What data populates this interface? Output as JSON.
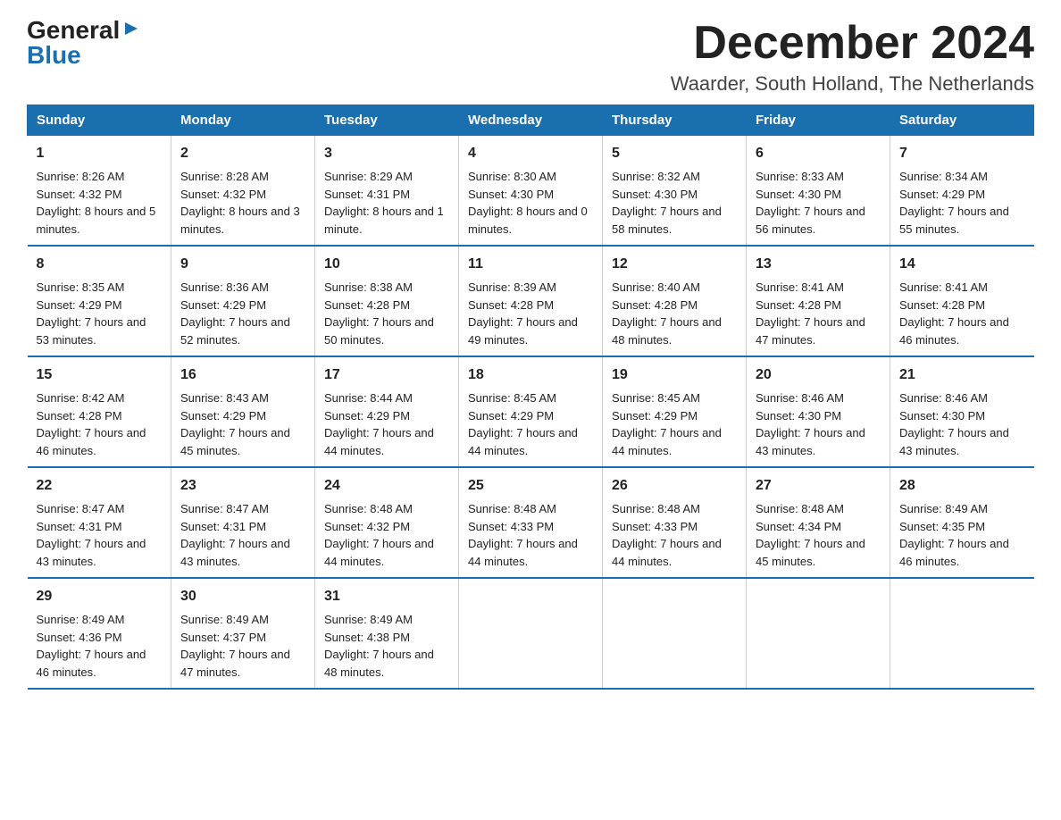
{
  "logo": {
    "general": "General",
    "triangle": "▶",
    "blue": "Blue"
  },
  "header": {
    "month": "December 2024",
    "location": "Waarder, South Holland, The Netherlands"
  },
  "days": [
    "Sunday",
    "Monday",
    "Tuesday",
    "Wednesday",
    "Thursday",
    "Friday",
    "Saturday"
  ],
  "weeks": [
    [
      {
        "date": "1",
        "sunrise": "Sunrise: 8:26 AM",
        "sunset": "Sunset: 4:32 PM",
        "daylight": "Daylight: 8 hours and 5 minutes."
      },
      {
        "date": "2",
        "sunrise": "Sunrise: 8:28 AM",
        "sunset": "Sunset: 4:32 PM",
        "daylight": "Daylight: 8 hours and 3 minutes."
      },
      {
        "date": "3",
        "sunrise": "Sunrise: 8:29 AM",
        "sunset": "Sunset: 4:31 PM",
        "daylight": "Daylight: 8 hours and 1 minute."
      },
      {
        "date": "4",
        "sunrise": "Sunrise: 8:30 AM",
        "sunset": "Sunset: 4:30 PM",
        "daylight": "Daylight: 8 hours and 0 minutes."
      },
      {
        "date": "5",
        "sunrise": "Sunrise: 8:32 AM",
        "sunset": "Sunset: 4:30 PM",
        "daylight": "Daylight: 7 hours and 58 minutes."
      },
      {
        "date": "6",
        "sunrise": "Sunrise: 8:33 AM",
        "sunset": "Sunset: 4:30 PM",
        "daylight": "Daylight: 7 hours and 56 minutes."
      },
      {
        "date": "7",
        "sunrise": "Sunrise: 8:34 AM",
        "sunset": "Sunset: 4:29 PM",
        "daylight": "Daylight: 7 hours and 55 minutes."
      }
    ],
    [
      {
        "date": "8",
        "sunrise": "Sunrise: 8:35 AM",
        "sunset": "Sunset: 4:29 PM",
        "daylight": "Daylight: 7 hours and 53 minutes."
      },
      {
        "date": "9",
        "sunrise": "Sunrise: 8:36 AM",
        "sunset": "Sunset: 4:29 PM",
        "daylight": "Daylight: 7 hours and 52 minutes."
      },
      {
        "date": "10",
        "sunrise": "Sunrise: 8:38 AM",
        "sunset": "Sunset: 4:28 PM",
        "daylight": "Daylight: 7 hours and 50 minutes."
      },
      {
        "date": "11",
        "sunrise": "Sunrise: 8:39 AM",
        "sunset": "Sunset: 4:28 PM",
        "daylight": "Daylight: 7 hours and 49 minutes."
      },
      {
        "date": "12",
        "sunrise": "Sunrise: 8:40 AM",
        "sunset": "Sunset: 4:28 PM",
        "daylight": "Daylight: 7 hours and 48 minutes."
      },
      {
        "date": "13",
        "sunrise": "Sunrise: 8:41 AM",
        "sunset": "Sunset: 4:28 PM",
        "daylight": "Daylight: 7 hours and 47 minutes."
      },
      {
        "date": "14",
        "sunrise": "Sunrise: 8:41 AM",
        "sunset": "Sunset: 4:28 PM",
        "daylight": "Daylight: 7 hours and 46 minutes."
      }
    ],
    [
      {
        "date": "15",
        "sunrise": "Sunrise: 8:42 AM",
        "sunset": "Sunset: 4:28 PM",
        "daylight": "Daylight: 7 hours and 46 minutes."
      },
      {
        "date": "16",
        "sunrise": "Sunrise: 8:43 AM",
        "sunset": "Sunset: 4:29 PM",
        "daylight": "Daylight: 7 hours and 45 minutes."
      },
      {
        "date": "17",
        "sunrise": "Sunrise: 8:44 AM",
        "sunset": "Sunset: 4:29 PM",
        "daylight": "Daylight: 7 hours and 44 minutes."
      },
      {
        "date": "18",
        "sunrise": "Sunrise: 8:45 AM",
        "sunset": "Sunset: 4:29 PM",
        "daylight": "Daylight: 7 hours and 44 minutes."
      },
      {
        "date": "19",
        "sunrise": "Sunrise: 8:45 AM",
        "sunset": "Sunset: 4:29 PM",
        "daylight": "Daylight: 7 hours and 44 minutes."
      },
      {
        "date": "20",
        "sunrise": "Sunrise: 8:46 AM",
        "sunset": "Sunset: 4:30 PM",
        "daylight": "Daylight: 7 hours and 43 minutes."
      },
      {
        "date": "21",
        "sunrise": "Sunrise: 8:46 AM",
        "sunset": "Sunset: 4:30 PM",
        "daylight": "Daylight: 7 hours and 43 minutes."
      }
    ],
    [
      {
        "date": "22",
        "sunrise": "Sunrise: 8:47 AM",
        "sunset": "Sunset: 4:31 PM",
        "daylight": "Daylight: 7 hours and 43 minutes."
      },
      {
        "date": "23",
        "sunrise": "Sunrise: 8:47 AM",
        "sunset": "Sunset: 4:31 PM",
        "daylight": "Daylight: 7 hours and 43 minutes."
      },
      {
        "date": "24",
        "sunrise": "Sunrise: 8:48 AM",
        "sunset": "Sunset: 4:32 PM",
        "daylight": "Daylight: 7 hours and 44 minutes."
      },
      {
        "date": "25",
        "sunrise": "Sunrise: 8:48 AM",
        "sunset": "Sunset: 4:33 PM",
        "daylight": "Daylight: 7 hours and 44 minutes."
      },
      {
        "date": "26",
        "sunrise": "Sunrise: 8:48 AM",
        "sunset": "Sunset: 4:33 PM",
        "daylight": "Daylight: 7 hours and 44 minutes."
      },
      {
        "date": "27",
        "sunrise": "Sunrise: 8:48 AM",
        "sunset": "Sunset: 4:34 PM",
        "daylight": "Daylight: 7 hours and 45 minutes."
      },
      {
        "date": "28",
        "sunrise": "Sunrise: 8:49 AM",
        "sunset": "Sunset: 4:35 PM",
        "daylight": "Daylight: 7 hours and 46 minutes."
      }
    ],
    [
      {
        "date": "29",
        "sunrise": "Sunrise: 8:49 AM",
        "sunset": "Sunset: 4:36 PM",
        "daylight": "Daylight: 7 hours and 46 minutes."
      },
      {
        "date": "30",
        "sunrise": "Sunrise: 8:49 AM",
        "sunset": "Sunset: 4:37 PM",
        "daylight": "Daylight: 7 hours and 47 minutes."
      },
      {
        "date": "31",
        "sunrise": "Sunrise: 8:49 AM",
        "sunset": "Sunset: 4:38 PM",
        "daylight": "Daylight: 7 hours and 48 minutes."
      },
      null,
      null,
      null,
      null
    ]
  ]
}
